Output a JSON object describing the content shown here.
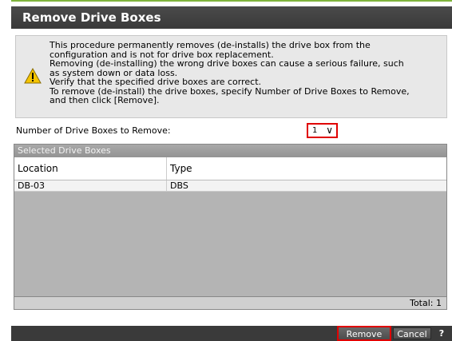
{
  "dialog": {
    "title": "Remove Drive Boxes"
  },
  "warning": {
    "icon": "warning-triangle-icon",
    "lines": [
      "This procedure permanently removes (de-installs) the drive box from the\nconfiguration and is not for drive box replacement.",
      "Removing (de-installing) the wrong drive boxes can cause a serious failure, such\nas system down or data loss.",
      "Verify that the specified drive boxes are correct.",
      "To remove (de-install) the drive boxes, specify Number of Drive Boxes to Remove,\nand then click [Remove]."
    ]
  },
  "count": {
    "label": "Number of Drive Boxes to Remove:",
    "value": "1"
  },
  "table": {
    "section_title": "Selected Drive Boxes",
    "columns": [
      "Location",
      "Type"
    ],
    "rows": [
      {
        "location": "DB-03",
        "type": "DBS"
      }
    ],
    "total": "Total: 1"
  },
  "footer": {
    "remove_label": "Remove",
    "cancel_label": "Cancel",
    "help_label": "?"
  },
  "colors": {
    "title_bar": "#3a3a3a",
    "accent": "#7fb43c",
    "highlight_border": "#e00000",
    "warning_bg": "#e8e8e8",
    "warning_icon": "#f5c400"
  }
}
